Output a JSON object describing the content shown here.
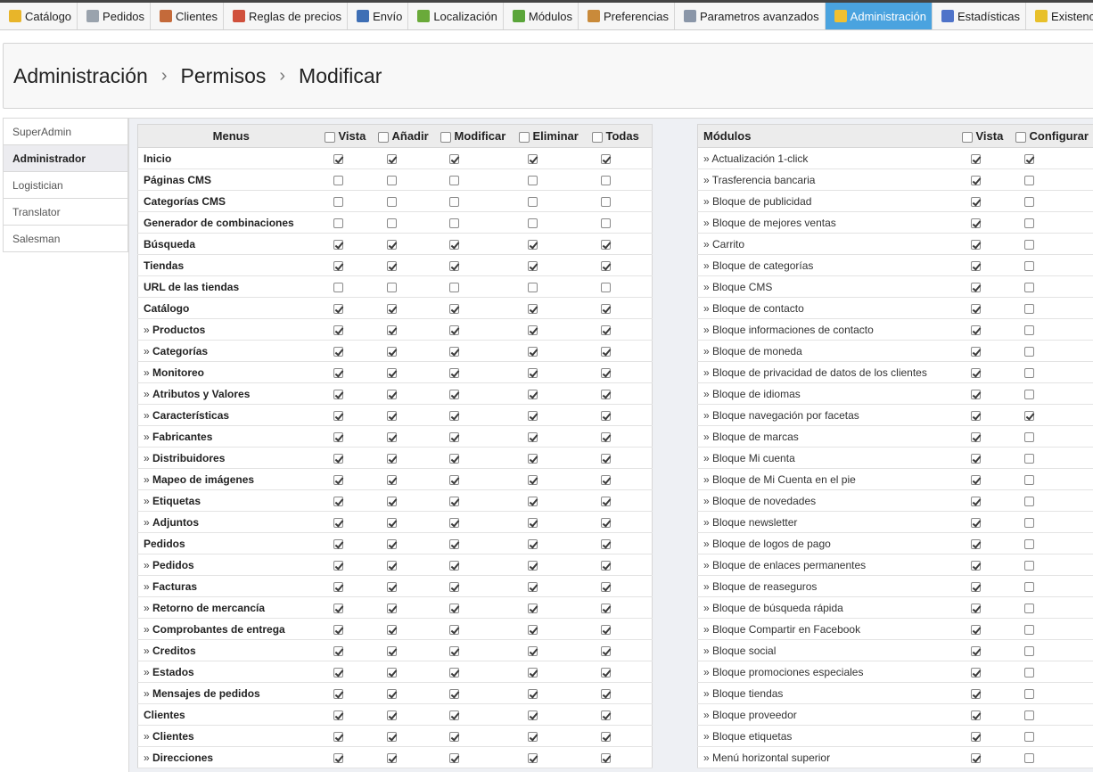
{
  "nav": {
    "tabs": [
      {
        "label": "Catálogo",
        "icon": "folder-icon",
        "color": "#e8b52a",
        "active": false
      },
      {
        "label": "Pedidos",
        "icon": "cart-icon",
        "color": "#9aa3ad",
        "active": false
      },
      {
        "label": "Clientes",
        "icon": "user-icon",
        "color": "#c46a3a",
        "active": false
      },
      {
        "label": "Reglas de precios",
        "icon": "price-rules-icon",
        "color": "#d0503c",
        "active": false
      },
      {
        "label": "Envío",
        "icon": "truck-icon",
        "color": "#3e6fb5",
        "active": false
      },
      {
        "label": "Localización",
        "icon": "globe-icon",
        "color": "#6aaa3a",
        "active": false
      },
      {
        "label": "Módulos",
        "icon": "puzzle-icon",
        "color": "#5aa53a",
        "active": false
      },
      {
        "label": "Preferencias",
        "icon": "preferences-icon",
        "color": "#c98a3a",
        "active": false
      },
      {
        "label": "Parametros avanzados",
        "icon": "wrench-icon",
        "color": "#8a96a8",
        "active": false
      },
      {
        "label": "Administración",
        "icon": "key-icon",
        "color": "#f0c030",
        "active": true
      },
      {
        "label": "Estadísticas",
        "icon": "chart-icon",
        "color": "#4f73c9",
        "active": false
      },
      {
        "label": "Existencias",
        "icon": "stock-icon",
        "color": "#e8c02a",
        "active": false
      }
    ],
    "active_color": "#4aa3df"
  },
  "breadcrumb": {
    "items": [
      "Administración",
      "Permisos",
      "Modificar"
    ],
    "separator": "›"
  },
  "profiles": {
    "items": [
      {
        "label": "SuperAdmin",
        "active": false
      },
      {
        "label": "Administrador",
        "active": true
      },
      {
        "label": "Logistician",
        "active": false
      },
      {
        "label": "Translator",
        "active": false
      },
      {
        "label": "Salesman",
        "active": false
      }
    ]
  },
  "menus_table": {
    "headers": {
      "name": "Menus",
      "view": "Vista",
      "add": "Añadir",
      "edit": "Modificar",
      "delete": "Eliminar",
      "all": "Todas"
    },
    "rows": [
      {
        "name": "Inicio",
        "sub": false,
        "view": true,
        "add": true,
        "edit": true,
        "delete": true,
        "all": true
      },
      {
        "name": "Páginas CMS",
        "sub": false,
        "view": false,
        "add": false,
        "edit": false,
        "delete": false,
        "all": false
      },
      {
        "name": "Categorías CMS",
        "sub": false,
        "view": false,
        "add": false,
        "edit": false,
        "delete": false,
        "all": false
      },
      {
        "name": "Generador de combinaciones",
        "sub": false,
        "view": false,
        "add": false,
        "edit": false,
        "delete": false,
        "all": false
      },
      {
        "name": "Búsqueda",
        "sub": false,
        "view": true,
        "add": true,
        "edit": true,
        "delete": true,
        "all": true
      },
      {
        "name": "Tiendas",
        "sub": false,
        "view": true,
        "add": true,
        "edit": true,
        "delete": true,
        "all": true
      },
      {
        "name": "URL de las tiendas",
        "sub": false,
        "view": false,
        "add": false,
        "edit": false,
        "delete": false,
        "all": false
      },
      {
        "name": "Catálogo",
        "sub": false,
        "view": true,
        "add": true,
        "edit": true,
        "delete": true,
        "all": true
      },
      {
        "name": "Productos",
        "sub": true,
        "view": true,
        "add": true,
        "edit": true,
        "delete": true,
        "all": true
      },
      {
        "name": "Categorías",
        "sub": true,
        "view": true,
        "add": true,
        "edit": true,
        "delete": true,
        "all": true
      },
      {
        "name": "Monitoreo",
        "sub": true,
        "view": true,
        "add": true,
        "edit": true,
        "delete": true,
        "all": true
      },
      {
        "name": "Atributos y Valores",
        "sub": true,
        "view": true,
        "add": true,
        "edit": true,
        "delete": true,
        "all": true
      },
      {
        "name": "Características",
        "sub": true,
        "view": true,
        "add": true,
        "edit": true,
        "delete": true,
        "all": true
      },
      {
        "name": "Fabricantes",
        "sub": true,
        "view": true,
        "add": true,
        "edit": true,
        "delete": true,
        "all": true
      },
      {
        "name": "Distribuidores",
        "sub": true,
        "view": true,
        "add": true,
        "edit": true,
        "delete": true,
        "all": true
      },
      {
        "name": "Mapeo de imágenes",
        "sub": true,
        "view": true,
        "add": true,
        "edit": true,
        "delete": true,
        "all": true
      },
      {
        "name": "Etiquetas",
        "sub": true,
        "view": true,
        "add": true,
        "edit": true,
        "delete": true,
        "all": true
      },
      {
        "name": "Adjuntos",
        "sub": true,
        "view": true,
        "add": true,
        "edit": true,
        "delete": true,
        "all": true
      },
      {
        "name": "Pedidos",
        "sub": false,
        "view": true,
        "add": true,
        "edit": true,
        "delete": true,
        "all": true
      },
      {
        "name": "Pedidos",
        "sub": true,
        "view": true,
        "add": true,
        "edit": true,
        "delete": true,
        "all": true
      },
      {
        "name": "Facturas",
        "sub": true,
        "view": true,
        "add": true,
        "edit": true,
        "delete": true,
        "all": true
      },
      {
        "name": "Retorno de mercancía",
        "sub": true,
        "view": true,
        "add": true,
        "edit": true,
        "delete": true,
        "all": true
      },
      {
        "name": "Comprobantes de entrega",
        "sub": true,
        "view": true,
        "add": true,
        "edit": true,
        "delete": true,
        "all": true
      },
      {
        "name": "Creditos",
        "sub": true,
        "view": true,
        "add": true,
        "edit": true,
        "delete": true,
        "all": true
      },
      {
        "name": "Estados",
        "sub": true,
        "view": true,
        "add": true,
        "edit": true,
        "delete": true,
        "all": true
      },
      {
        "name": "Mensajes de pedidos",
        "sub": true,
        "view": true,
        "add": true,
        "edit": true,
        "delete": true,
        "all": true
      },
      {
        "name": "Clientes",
        "sub": false,
        "view": true,
        "add": true,
        "edit": true,
        "delete": true,
        "all": true
      },
      {
        "name": "Clientes",
        "sub": true,
        "view": true,
        "add": true,
        "edit": true,
        "delete": true,
        "all": true
      },
      {
        "name": "Direcciones",
        "sub": true,
        "view": true,
        "add": true,
        "edit": true,
        "delete": true,
        "all": true
      }
    ]
  },
  "modules_table": {
    "headers": {
      "name": "Módulos",
      "view": "Vista",
      "configure": "Configurar"
    },
    "rows": [
      {
        "name": "Actualización 1-click",
        "view": true,
        "configure": true
      },
      {
        "name": "Trasferencia bancaria",
        "view": true,
        "configure": false
      },
      {
        "name": "Bloque de publicidad",
        "view": true,
        "configure": false
      },
      {
        "name": "Bloque de mejores ventas",
        "view": true,
        "configure": false
      },
      {
        "name": "Carrito",
        "view": true,
        "configure": false
      },
      {
        "name": "Bloque de categorías",
        "view": true,
        "configure": false
      },
      {
        "name": "Bloque CMS",
        "view": true,
        "configure": false
      },
      {
        "name": "Bloque de contacto",
        "view": true,
        "configure": false
      },
      {
        "name": "Bloque informaciones de contacto",
        "view": true,
        "configure": false
      },
      {
        "name": "Bloque de moneda",
        "view": true,
        "configure": false
      },
      {
        "name": "Bloque de privacidad de datos de los clientes",
        "view": true,
        "configure": false
      },
      {
        "name": "Bloque de idiomas",
        "view": true,
        "configure": false
      },
      {
        "name": "Bloque navegación por facetas",
        "view": true,
        "configure": true
      },
      {
        "name": "Bloque de marcas",
        "view": true,
        "configure": false
      },
      {
        "name": "Bloque Mi cuenta",
        "view": true,
        "configure": false
      },
      {
        "name": "Bloque de Mi Cuenta en el pie",
        "view": true,
        "configure": false
      },
      {
        "name": "Bloque de novedades",
        "view": true,
        "configure": false
      },
      {
        "name": "Bloque newsletter",
        "view": true,
        "configure": false
      },
      {
        "name": "Bloque de logos de pago",
        "view": true,
        "configure": false
      },
      {
        "name": "Bloque de enlaces permanentes",
        "view": true,
        "configure": false
      },
      {
        "name": "Bloque de reaseguros",
        "view": true,
        "configure": false
      },
      {
        "name": "Bloque de búsqueda rápida",
        "view": true,
        "configure": false
      },
      {
        "name": "Bloque Compartir en Facebook",
        "view": true,
        "configure": false
      },
      {
        "name": "Bloque social",
        "view": true,
        "configure": false
      },
      {
        "name": "Bloque promociones especiales",
        "view": true,
        "configure": false
      },
      {
        "name": "Bloque tiendas",
        "view": true,
        "configure": false
      },
      {
        "name": "Bloque proveedor",
        "view": true,
        "configure": false
      },
      {
        "name": "Bloque etiquetas",
        "view": true,
        "configure": false
      },
      {
        "name": "Menú horizontal superior",
        "view": true,
        "configure": false
      }
    ]
  }
}
